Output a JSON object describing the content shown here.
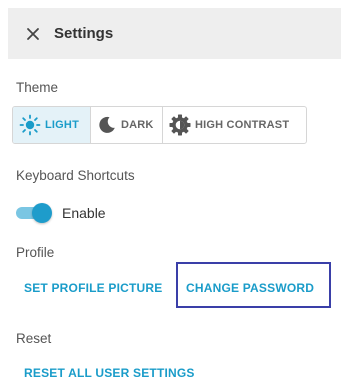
{
  "header": {
    "title": "Settings"
  },
  "theme": {
    "label": "Theme",
    "options": [
      {
        "label": "LIGHT",
        "icon": "sun-icon",
        "active": true
      },
      {
        "label": "DARK",
        "icon": "moon-icon",
        "active": false
      },
      {
        "label": "HIGH CONTRAST",
        "icon": "contrast-gear-icon",
        "active": false
      }
    ]
  },
  "keyboard": {
    "label": "Keyboard Shortcuts",
    "toggle_label": "Enable",
    "enabled": true
  },
  "profile": {
    "label": "Profile",
    "set_picture": "SET PROFILE PICTURE",
    "change_password": "CHANGE PASSWORD"
  },
  "reset": {
    "label": "Reset",
    "reset_all": "RESET ALL USER SETTINGS"
  },
  "colors": {
    "accent": "#1a9cc9",
    "header_bg": "#eeeeee",
    "active_bg": "#e4f2f8",
    "focus_outline": "#3a3fa8"
  }
}
